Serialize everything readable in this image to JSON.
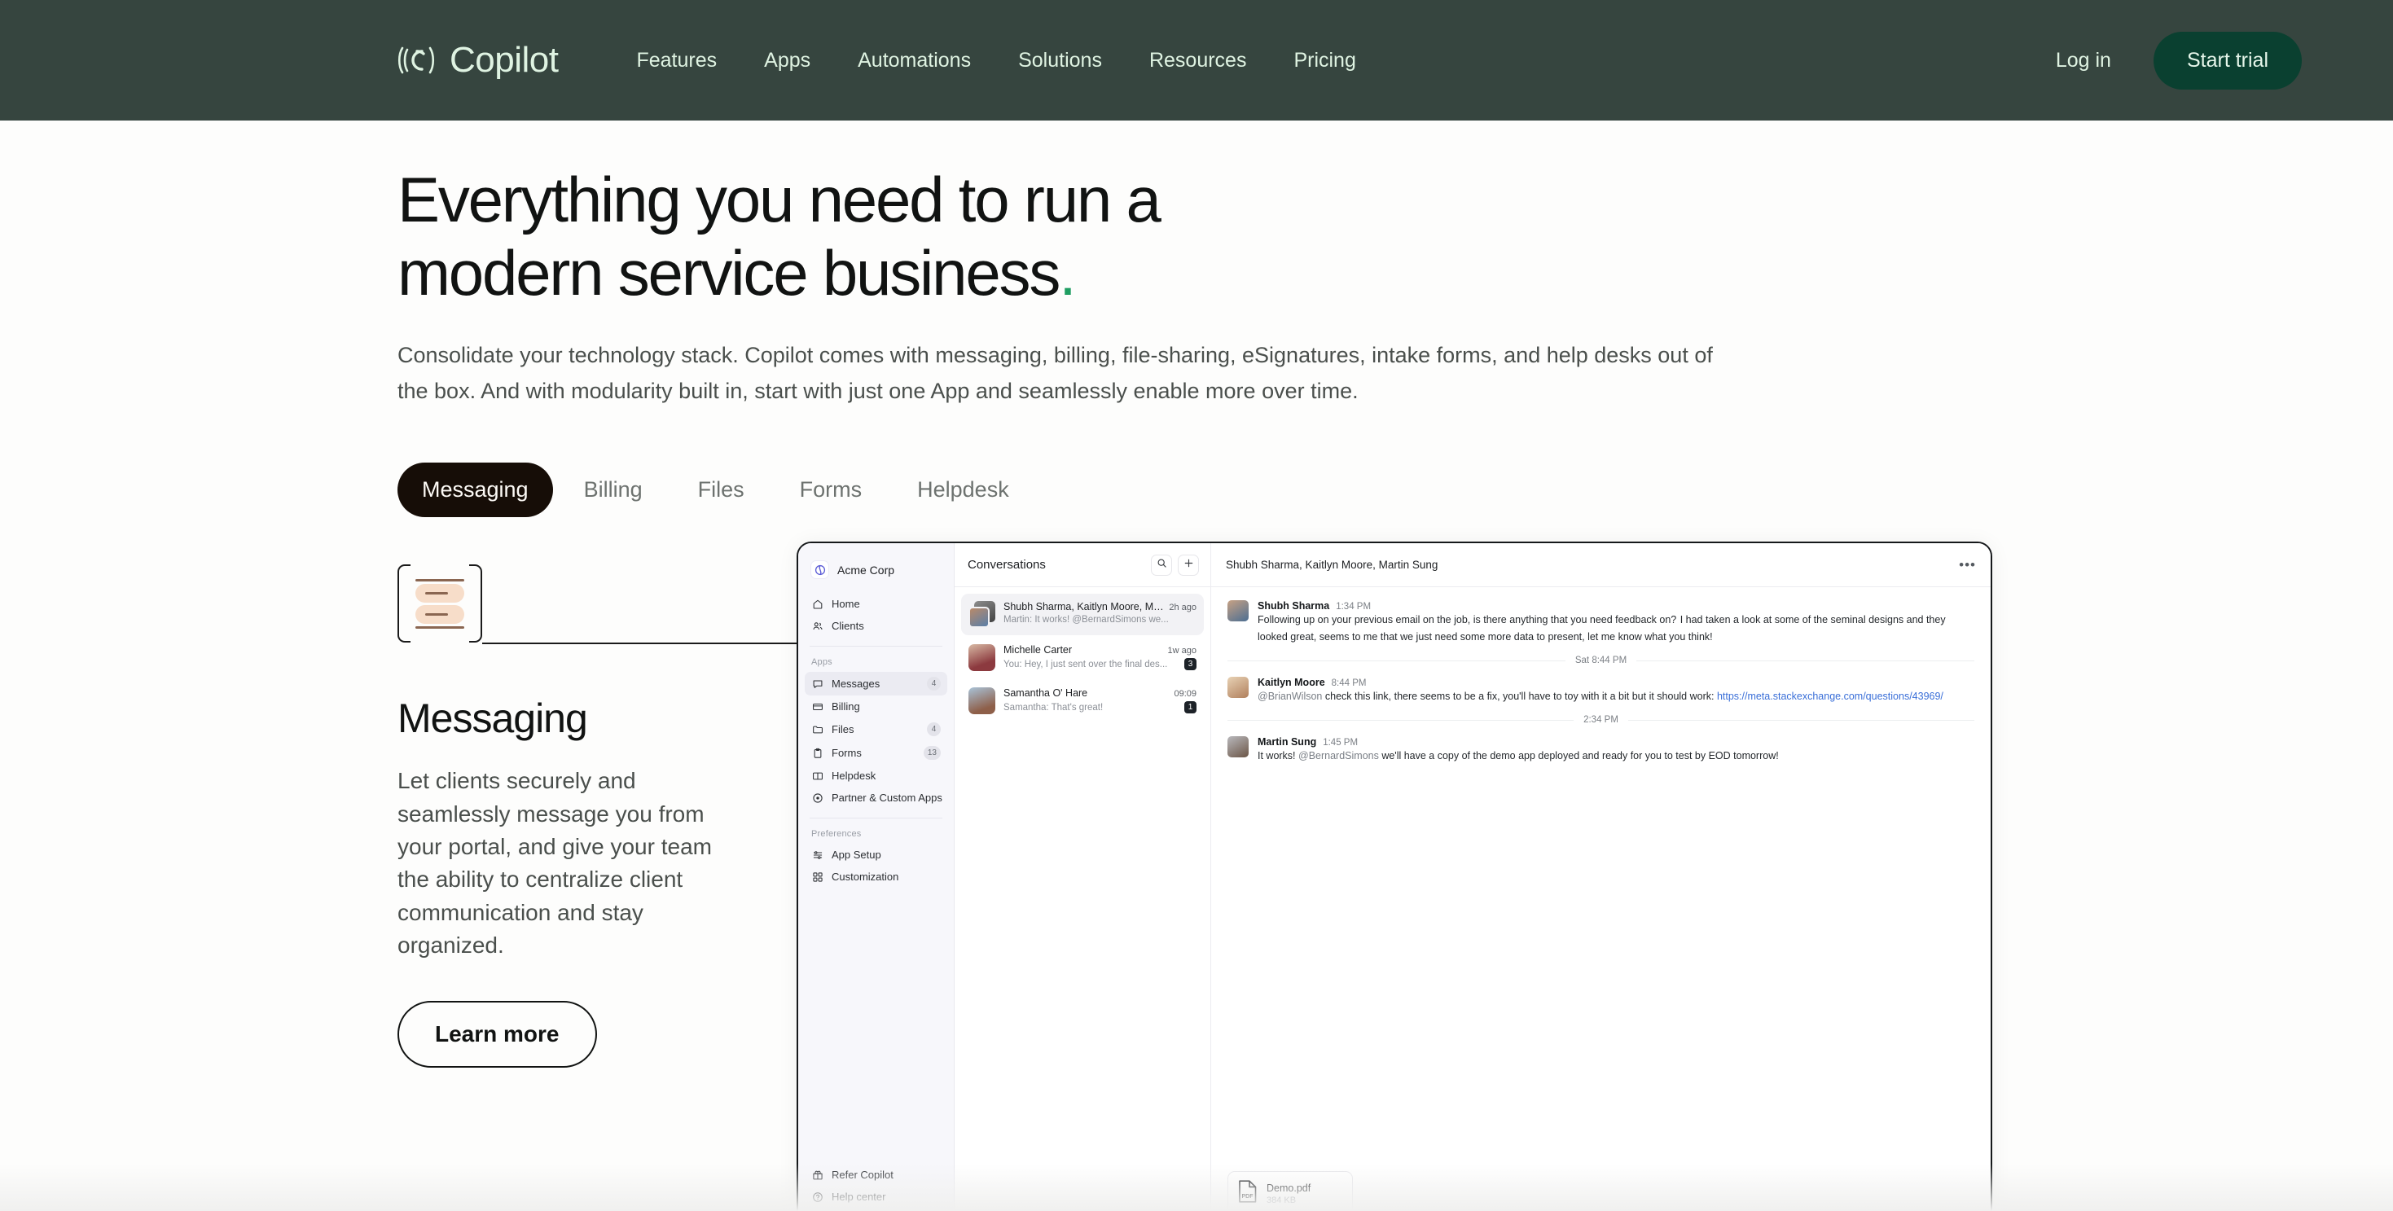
{
  "header": {
    "brand": "Copilot",
    "brand_icon": "copilot-logo-icon",
    "nav": [
      {
        "label": "Features"
      },
      {
        "label": "Apps"
      },
      {
        "label": "Automations"
      },
      {
        "label": "Solutions"
      },
      {
        "label": "Resources"
      },
      {
        "label": "Pricing"
      }
    ],
    "login_label": "Log in",
    "trial_label": "Start trial",
    "bg_color": "#36453F",
    "text_color": "#DFF3E2",
    "trial_bg": "#0A4030"
  },
  "hero": {
    "title_line1": "Everything you need to run a",
    "title_line2": "modern service business",
    "title_dot": ".",
    "dot_color": "#1F9E62",
    "subtitle": "Consolidate your technology stack. Copilot comes with messaging, billing, file-sharing, eSignatures, intake forms, and help desks out of the box. And with modularity built in, start with just one App and seamlessly enable more over time."
  },
  "tabs": [
    {
      "label": "Messaging",
      "active": true
    },
    {
      "label": "Billing",
      "active": false
    },
    {
      "label": "Files",
      "active": false
    },
    {
      "label": "Forms",
      "active": false
    },
    {
      "label": "Helpdesk",
      "active": false
    }
  ],
  "feature": {
    "icon_name": "messaging-icon",
    "title": "Messaging",
    "description": "Let clients securely and seamlessly message you from your portal, and give your team the ability to centralize client communication and stay organized.",
    "cta_label": "Learn more"
  },
  "app": {
    "workspace": "Acme Corp",
    "nav_primary": [
      {
        "label": "Home",
        "icon": "home-icon",
        "badge": ""
      },
      {
        "label": "Clients",
        "icon": "clients-icon",
        "badge": ""
      }
    ],
    "apps_label": "Apps",
    "nav_apps": [
      {
        "label": "Messages",
        "icon": "message-icon",
        "badge": "4",
        "selected": true
      },
      {
        "label": "Billing",
        "icon": "billing-icon",
        "badge": "",
        "selected": false
      },
      {
        "label": "Files",
        "icon": "files-icon",
        "badge": "4",
        "selected": false
      },
      {
        "label": "Forms",
        "icon": "forms-icon",
        "badge": "13",
        "selected": false
      },
      {
        "label": "Helpdesk",
        "icon": "helpdesk-icon",
        "badge": "",
        "selected": false
      },
      {
        "label": "Partner & Custom Apps",
        "icon": "partner-apps-icon",
        "badge": "",
        "selected": false
      }
    ],
    "preferences_label": "Preferences",
    "nav_prefs": [
      {
        "label": "App Setup",
        "icon": "app-setup-icon"
      },
      {
        "label": "Customization",
        "icon": "customization-icon"
      }
    ],
    "nav_bottom": [
      {
        "label": "Refer Copilot",
        "icon": "gift-icon"
      },
      {
        "label": "Help center",
        "icon": "help-icon"
      }
    ],
    "conversations": {
      "title": "Conversations",
      "search_icon": "search-icon",
      "add_icon": "plus-icon",
      "items": [
        {
          "name": "Shubh Sharma, Kaitlyn Moore, Marti...",
          "preview": "Martin: It works! @BernardSimons we...",
          "time": "2h ago",
          "unread": "",
          "selected": true,
          "avatar_style": "stack"
        },
        {
          "name": "Michelle Carter",
          "preview": "You: Hey, I just sent over the final des...",
          "time": "1w ago",
          "unread": "3",
          "selected": false,
          "avatar_style": "single"
        },
        {
          "name": "Samantha O' Hare",
          "preview": "Samantha: That's great!",
          "time": "09:09",
          "unread": "1",
          "selected": false,
          "avatar_style": "single"
        }
      ]
    },
    "thread": {
      "title": "Shubh Sharma, Kaitlyn Moore, Martin Sung",
      "more_icon": "more-options-icon",
      "messages": [
        {
          "type": "message",
          "author": "Shubh Sharma",
          "time": "1:34 PM",
          "paragraphs": [
            "Following up on your previous email on the job, is there anything that you need feedback on?",
            "I had taken a look at some of the seminal designs and they looked great, seems to me that we just need some more data to present, let me know what you think!"
          ]
        },
        {
          "type": "divider",
          "label": "Sat 8:44 PM"
        },
        {
          "type": "message",
          "author": "Kaitlyn Moore",
          "time": "8:44 PM",
          "mention": "@BrianWilson",
          "body_before": " check this link, there seems to be a fix, you'll have to toy with it a bit but it should work: ",
          "link": "https://meta.stackexchange.com/questions/43969/"
        },
        {
          "type": "divider",
          "label": "2:34 PM"
        },
        {
          "type": "message",
          "author": "Martin Sung",
          "time": "1:45 PM",
          "body_before": "It works! ",
          "mention": "@BernardSimons",
          "body_after": " we'll have a copy of the demo app deployed and ready for you to test by EOD tomorrow!"
        }
      ],
      "attachment": {
        "name": "Demo.pdf",
        "size": "384 KB",
        "icon": "pdf-file-icon",
        "badge_text": "PDF"
      }
    }
  }
}
